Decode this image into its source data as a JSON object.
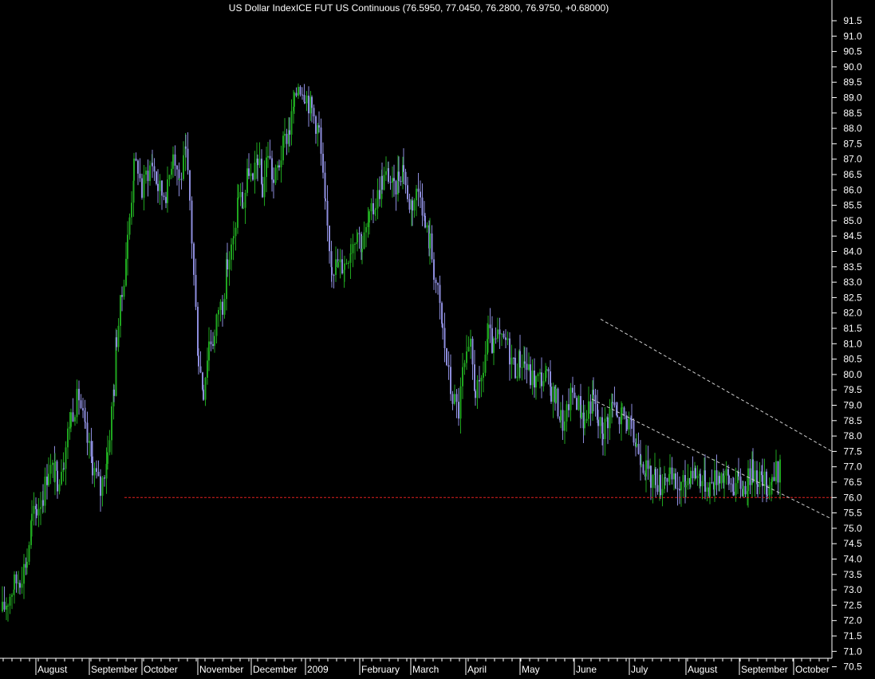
{
  "chart_data": {
    "type": "ohlc",
    "title": "US Dollar IndexICE FUT US Continuous (76.5950, 77.0450, 76.2800, 76.9750, +0.68000)",
    "ylim": [
      70.0,
      91.75
    ],
    "y_ticks": [
      70.5,
      71.0,
      71.5,
      72.0,
      72.5,
      73.0,
      73.5,
      74.0,
      74.5,
      75.0,
      75.5,
      76.0,
      76.5,
      77.0,
      77.5,
      78.0,
      78.5,
      79.0,
      79.5,
      80.0,
      80.5,
      81.0,
      81.5,
      82.0,
      82.5,
      83.0,
      83.5,
      84.0,
      84.5,
      85.0,
      85.5,
      86.0,
      86.5,
      87.0,
      87.5,
      88.0,
      88.5,
      89.0,
      89.5,
      90.0,
      90.5,
      91.0,
      91.5
    ],
    "x_labels": [
      "August",
      "September",
      "October",
      "November",
      "December",
      "2009",
      "February",
      "March",
      "April",
      "May",
      "June",
      "July",
      "August",
      "September",
      "October"
    ],
    "grid": false,
    "colors": {
      "background": "#000000",
      "up_bar": "#1fa51f",
      "down_bar": "#8d8ddc",
      "axis": "#ffffff",
      "support_line": "#e02020",
      "channel_line": "#cfcfcf"
    },
    "series": [
      {
        "x": [
          0,
          7,
          15,
          22,
          31,
          37,
          43,
          51,
          58,
          66,
          69,
          77,
          86,
          96,
          104,
          113,
          123,
          132,
          140,
          143,
          150,
          157,
          165,
          170,
          175,
          180,
          188,
          195,
          200,
          207,
          214,
          222,
          230,
          235,
          240,
          246,
          252,
          259,
          266,
          271,
          276,
          282,
          290,
          296,
          302,
          309,
          314,
          320,
          326,
          333,
          340,
          347,
          354,
          360,
          366,
          371,
          379,
          388,
          397,
          405,
          413,
          421,
          429,
          437,
          445,
          451,
          460,
          468,
          476,
          484,
          491,
          497,
          503,
          508,
          514,
          519,
          524,
          530,
          536,
          541,
          546,
          552,
          557,
          562,
          567,
          572,
          577,
          582,
          587,
          593,
          598,
          603,
          609,
          616,
          621,
          626,
          631,
          636,
          643,
          649,
          655,
          662,
          669,
          676,
          682,
          688,
          694,
          700,
          705,
          710,
          715,
          720,
          726,
          730,
          735,
          741,
          747,
          753,
          759,
          765,
          771,
          777,
          783,
          789,
          795,
          801,
          807,
          813,
          819,
          825,
          831,
          837,
          844,
          851,
          857,
          863,
          869,
          875,
          881,
          887,
          893,
          899,
          905,
          911,
          917,
          923,
          929,
          935,
          941,
          947,
          953,
          959,
          965,
          970,
          975
        ],
        "values": [
          72.3,
          72.7,
          73.2,
          73.4,
          74.0,
          75.3,
          75.6,
          76.1,
          77.0,
          76.8,
          76.6,
          77.3,
          78.7,
          79.3,
          78.1,
          77.1,
          76.2,
          77.5,
          79.6,
          81.2,
          82.6,
          84.4,
          86.7,
          86.8,
          85.9,
          86.5,
          86.9,
          86.1,
          85.9,
          86.0,
          87.4,
          86.3,
          87.1,
          85.6,
          83.2,
          80.5,
          79.5,
          81.1,
          81.2,
          82.2,
          82.3,
          83.6,
          84.3,
          85.9,
          85.5,
          86.7,
          86.1,
          87.1,
          86.0,
          87.3,
          86.2,
          86.9,
          87.6,
          88.0,
          88.8,
          89.5,
          89.2,
          88.6,
          87.9,
          85.3,
          83.6,
          83.5,
          83.6,
          84.2,
          84.7,
          84.2,
          85.0,
          85.6,
          86.3,
          86.5,
          85.9,
          86.5,
          86.8,
          85.6,
          85.6,
          85.9,
          86.1,
          84.8,
          84.3,
          83.4,
          82.6,
          81.4,
          80.4,
          79.5,
          79.1,
          78.8,
          80.0,
          80.4,
          80.8,
          79.5,
          79.4,
          80.2,
          81.3,
          80.8,
          81.2,
          81.0,
          81.1,
          80.7,
          80.2,
          80.5,
          80.4,
          79.9,
          79.8,
          79.9,
          79.9,
          79.5,
          79.2,
          78.6,
          78.3,
          79.1,
          79.4,
          79.2,
          78.8,
          78.4,
          79.0,
          79.2,
          78.4,
          78.2,
          78.6,
          79.1,
          78.5,
          78.7,
          78.5,
          78.1,
          77.7,
          77.4,
          76.9,
          76.6,
          76.7,
          76.4,
          76.8,
          76.6,
          76.4,
          76.3,
          76.5,
          76.9,
          76.8,
          76.7,
          76.5,
          76.4,
          76.6,
          76.8,
          76.7,
          76.5,
          76.4,
          76.5,
          76.3,
          76.6,
          76.9,
          76.7,
          76.5,
          76.4,
          76.6,
          76.8,
          76.9
        ]
      }
    ],
    "support_level": 76.0,
    "channel": {
      "upper": [
        [
          753,
          81.8
        ],
        [
          1043,
          77.5
        ]
      ],
      "lower": [
        [
          742,
          79.2
        ],
        [
          1043,
          75.3
        ]
      ]
    }
  }
}
